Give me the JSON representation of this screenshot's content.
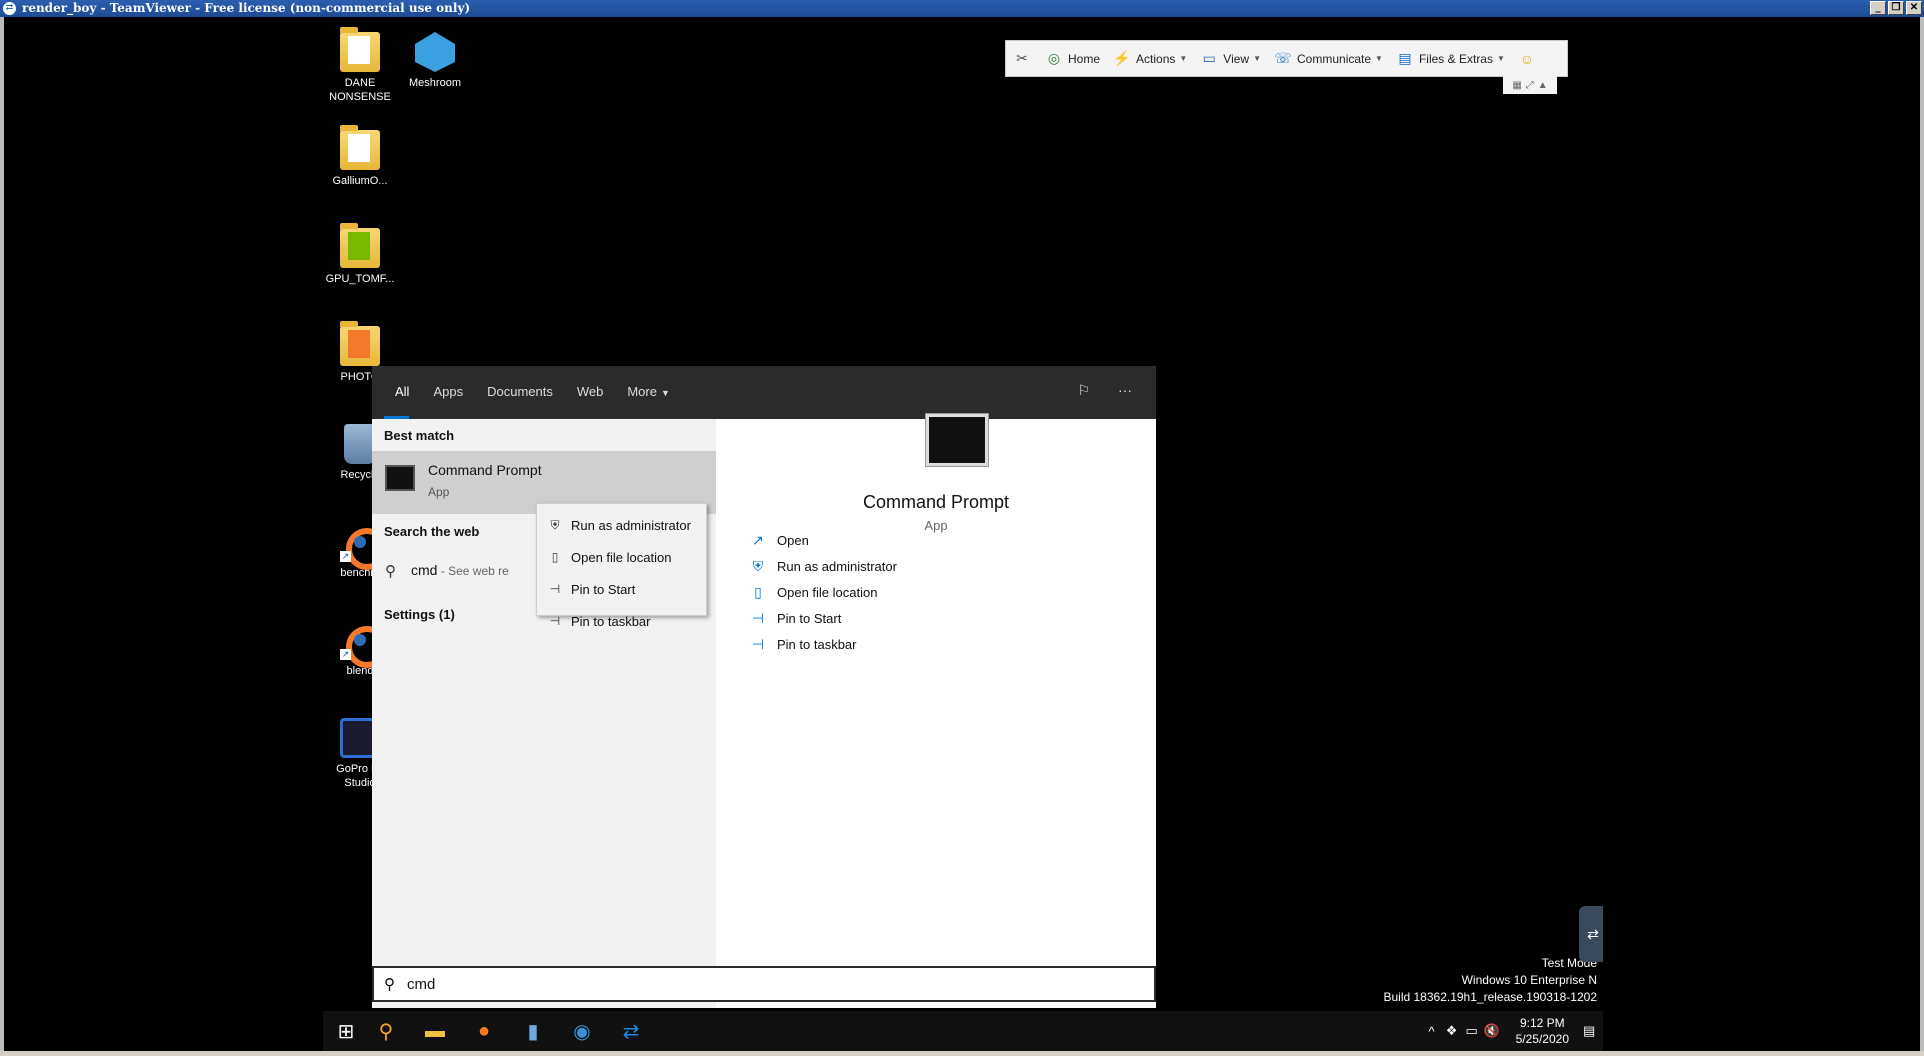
{
  "window": {
    "title": "render_boy - TeamViewer - Free license (non-commercial use only)",
    "buttons": [
      "_",
      "❐",
      "✕"
    ]
  },
  "tv_toolbar": {
    "items": [
      {
        "label": "",
        "icon": "close-session-icon"
      },
      {
        "label": "Home",
        "icon": "home-icon"
      },
      {
        "label": "Actions",
        "icon": "lightning-icon"
      },
      {
        "label": "View",
        "icon": "monitor-icon"
      },
      {
        "label": "Communicate",
        "icon": "phone-icon"
      },
      {
        "label": "Files & Extras",
        "icon": "files-icon"
      },
      {
        "label": "",
        "icon": "smiley-icon"
      }
    ]
  },
  "desktop_icons": [
    {
      "label": "DANE NONSENSE",
      "icon": "folder-icon"
    },
    {
      "label": "Meshroom",
      "icon": "meshroom-icon"
    },
    {
      "label": "GalliumO...",
      "icon": "folder-icon"
    },
    {
      "label": "GPU_TOMF...",
      "icon": "nvidia-folder-icon"
    },
    {
      "label": "PHOTO",
      "icon": "blender-folder-icon"
    },
    {
      "label": "Recycle",
      "icon": "recycle-bin-icon"
    },
    {
      "label": "benchm",
      "icon": "blender-icon"
    },
    {
      "label": "blend",
      "icon": "blender-icon"
    },
    {
      "label": "GoPro Fu Studio",
      "icon": "gopro-icon"
    }
  ],
  "search": {
    "tabs": [
      "All",
      "Apps",
      "Documents",
      "Web",
      "More"
    ],
    "best_match_title": "Best match",
    "best_match": {
      "name": "Command Prompt",
      "type": "App"
    },
    "web_title": "Search the web",
    "web_query": "cmd",
    "web_hint": " - See web re",
    "settings_title": "Settings (1)",
    "query": "cmd"
  },
  "detail": {
    "name": "Command Prompt",
    "type": "App",
    "actions": [
      "Open",
      "Run as administrator",
      "Open file location",
      "Pin to Start",
      "Pin to taskbar"
    ]
  },
  "context_menu": [
    "Run as administrator",
    "Open file location",
    "Pin to Start",
    "Pin to taskbar"
  ],
  "watermark": {
    "line1": "Test Mode",
    "line2": "Windows 10 Enterprise N",
    "line3": "Build 18362.19h1_release.190318-1202"
  },
  "clock": {
    "time": "9:12 PM",
    "date": "5/25/2020"
  },
  "colors": {
    "accent": "#0078d7",
    "taskbar": "#101010",
    "tab_bar": "#2b2b2b"
  }
}
